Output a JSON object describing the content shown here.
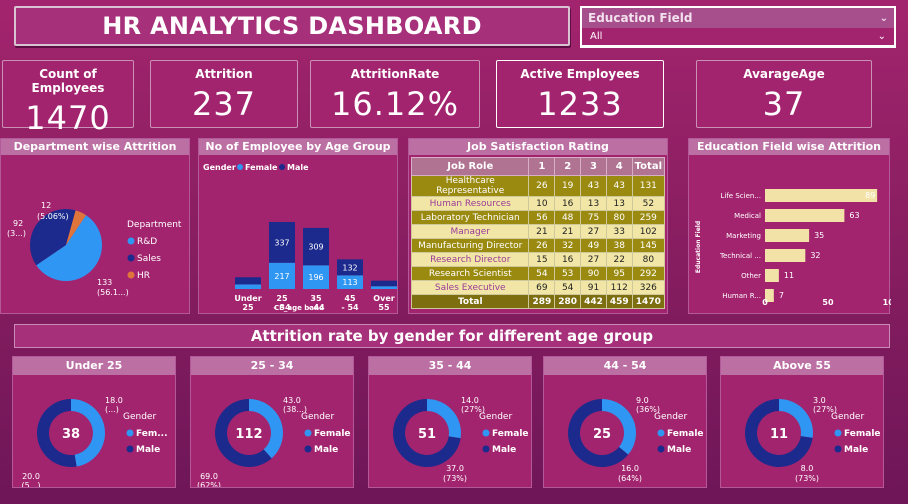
{
  "header": {
    "title": "HR ANALYTICS DASHBOARD"
  },
  "slicer": {
    "label": "Education Field",
    "value": "All"
  },
  "kpis": [
    {
      "label": "Count of Employees",
      "value": "1470"
    },
    {
      "label": "Attrition",
      "value": "237"
    },
    {
      "label": "AttritionRate",
      "value": "16.12%"
    },
    {
      "label": "Active Employees",
      "value": "1233"
    },
    {
      "label": "AvarageAge",
      "value": "37"
    }
  ],
  "colors": {
    "blue": "#2f96f3",
    "navy": "#1b2a8c",
    "orange": "#e0753c",
    "bar_light": "#f3e2a8"
  },
  "chart_data": [
    {
      "type": "pie",
      "title": "Department wise Attrition",
      "legend_title": "Department",
      "categories": [
        "R&D",
        "Sales",
        "HR"
      ],
      "values": [
        133,
        92,
        12
      ],
      "labels": [
        "133\n(56.1...)",
        "92\n(3...)",
        "12\n(5.06%)"
      ],
      "colors": [
        "#2f96f3",
        "#1b2a8c",
        "#e0753c"
      ],
      "legend_placement": "right"
    },
    {
      "type": "bar",
      "stacked": true,
      "title": "No of Employee by Age Group",
      "xlabel": "CF_age band",
      "legend_title": "Gender",
      "categories": [
        "Under 25",
        "25 - 34",
        "35 - 44",
        "45 - 54",
        "Over 55"
      ],
      "series": [
        {
          "name": "Female",
          "values": [
            38,
            217,
            196,
            113,
            23
          ]
        },
        {
          "name": "Male",
          "values": [
            59,
            337,
            309,
            132,
            46
          ]
        }
      ],
      "data_labels": {
        "Female": [
          "",
          "217",
          "196",
          "113",
          ""
        ],
        "Male": [
          "",
          "337",
          "309",
          "132",
          ""
        ]
      },
      "legend_placement": "top-left"
    },
    {
      "type": "table",
      "title": "Job Satisfaction Rating",
      "columns": [
        "Job Role",
        "1",
        "2",
        "3",
        "4",
        "Total"
      ],
      "rows": [
        [
          "Healthcare Representative",
          "26",
          "19",
          "43",
          "43",
          "131"
        ],
        [
          "Human Resources",
          "10",
          "16",
          "13",
          "13",
          "52"
        ],
        [
          "Laboratory Technician",
          "56",
          "48",
          "75",
          "80",
          "259"
        ],
        [
          "Manager",
          "21",
          "21",
          "27",
          "33",
          "102"
        ],
        [
          "Manufacturing Director",
          "26",
          "32",
          "49",
          "38",
          "145"
        ],
        [
          "Research Director",
          "15",
          "16",
          "27",
          "22",
          "80"
        ],
        [
          "Research Scientist",
          "54",
          "53",
          "90",
          "95",
          "292"
        ],
        [
          "Sales Executive",
          "69",
          "54",
          "91",
          "112",
          "326"
        ]
      ],
      "total": [
        "Total",
        "289",
        "280",
        "442",
        "459",
        "1470"
      ]
    },
    {
      "type": "bar",
      "orientation": "horizontal",
      "title": "Education Field wise Attrition",
      "ylabel": "Education Field",
      "categories": [
        "Life Scien...",
        "Medical",
        "Marketing",
        "Technical ...",
        "Other",
        "Human R..."
      ],
      "values": [
        89,
        63,
        35,
        32,
        11,
        7
      ],
      "xticks": [
        "0",
        "50",
        "100"
      ],
      "xlim": [
        0,
        100
      ]
    },
    {
      "type": "pie",
      "donut": true,
      "title": "Under 25",
      "center_value": "38",
      "legend_title": "Gender",
      "categories": [
        "Female",
        "Male"
      ],
      "values": [
        18,
        20
      ],
      "labels": [
        "18.0\n(...)",
        "20.0\n(5...)"
      ],
      "legend_labels": [
        "Fem...",
        "Male"
      ]
    },
    {
      "type": "pie",
      "donut": true,
      "title": "25 - 34",
      "center_value": "112",
      "legend_title": "Gender",
      "categories": [
        "Female",
        "Male"
      ],
      "values": [
        43,
        69
      ],
      "labels": [
        "43.0\n(38...)",
        "69.0\n(62%)"
      ],
      "legend_labels": [
        "Female",
        "Male"
      ]
    },
    {
      "type": "pie",
      "donut": true,
      "title": "35 - 44",
      "center_value": "51",
      "legend_title": "Gender",
      "categories": [
        "Female",
        "Male"
      ],
      "values": [
        14,
        37
      ],
      "labels": [
        "14.0\n(27%)",
        "37.0\n(73%)"
      ],
      "legend_labels": [
        "Female",
        "Male"
      ]
    },
    {
      "type": "pie",
      "donut": true,
      "title": "44 - 54",
      "center_value": "25",
      "legend_title": "Gender",
      "categories": [
        "Female",
        "Male"
      ],
      "values": [
        9,
        16
      ],
      "labels": [
        "9.0\n(36%)",
        "16.0\n(64%)"
      ],
      "legend_labels": [
        "Female",
        "Male"
      ]
    },
    {
      "type": "pie",
      "donut": true,
      "title": "Above 55",
      "center_value": "11",
      "legend_title": "Gender",
      "categories": [
        "Female",
        "Male"
      ],
      "values": [
        3,
        8
      ],
      "labels": [
        "3.0\n(27%)",
        "8.0\n(73%)"
      ],
      "legend_labels": [
        "Female",
        "Male"
      ]
    }
  ],
  "band": {
    "title": "Attrition rate by gender for different age group"
  }
}
